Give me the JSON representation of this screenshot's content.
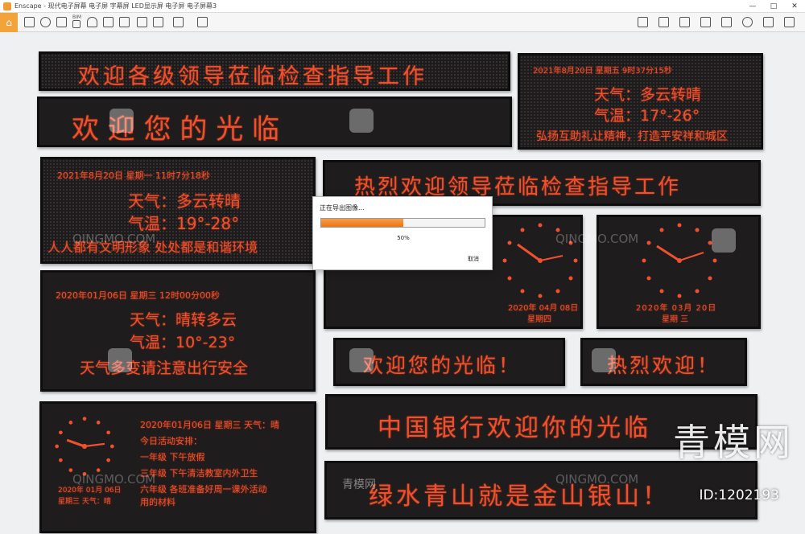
{
  "window": {
    "title": "Enscape - 现代电子屏幕 电子屏 字幕屏 LED显示屏 电子屏 电子屏幕3",
    "minimize": "—",
    "maximize": "□",
    "close": "✕"
  },
  "toolbar": {
    "bim_label": "BIM"
  },
  "panels": {
    "p1": "欢迎各级领导莅临检查指导工作",
    "p2": "欢  迎  您  的  光  临",
    "p3": {
      "line1": "2021年8月20日  星期五 9时37分15秒",
      "line2": "天气：多云转晴",
      "line3": "气温：17°-26°",
      "line4": "弘扬互助礼让精神，打造平安祥和城区"
    },
    "p4": {
      "line1": "2021年8月20日  星期一 11时7分18秒",
      "line2": "天气：多云转晴",
      "line3": "气温：19°-28°",
      "line4": "人人都有文明形象 处处都是和谐环境"
    },
    "p5": "热烈欢迎领导莅临检查指导工作",
    "p6": {
      "line1": "2020年01月06日  星期三 12时00分00秒",
      "line2": "天气：晴转多云",
      "line3": "气温：10°-23°",
      "line4": "天气多变请注意出行安全"
    },
    "clock1": {
      "date": "2020年 04月 08日",
      "day": "星期四"
    },
    "clock2": {
      "date": "2020年 03月 20日",
      "day": "星期 三"
    },
    "p7": "欢迎您的光临！",
    "p8": "热烈欢迎！",
    "p9": {
      "header": "2020年01月06日  星期三 天气：晴",
      "l1": "今日活动安排：",
      "l2": "一年级 下午放假",
      "l3": "三年级 下午清洁教室内外卫生",
      "l4": "六年级 各班准备好周一课外活动",
      "l5": "用的材料",
      "clock_date": "2020年 01月 06日",
      "clock_day": "星期三  天气：晴"
    },
    "p10": "中国银行欢迎你的光临",
    "p11": "绿水青山就是金山银山！"
  },
  "dialog": {
    "title": "正在导出图像...",
    "progress": 0.5,
    "percent_text": "50%",
    "cancel": "取消"
  },
  "watermarks": {
    "site": "QINGMO.COM",
    "brand": "青模网",
    "cn_small": "青模网",
    "id": "ID:1202193"
  },
  "colors": {
    "led": "#f0502e",
    "accent": "#f29b30"
  }
}
